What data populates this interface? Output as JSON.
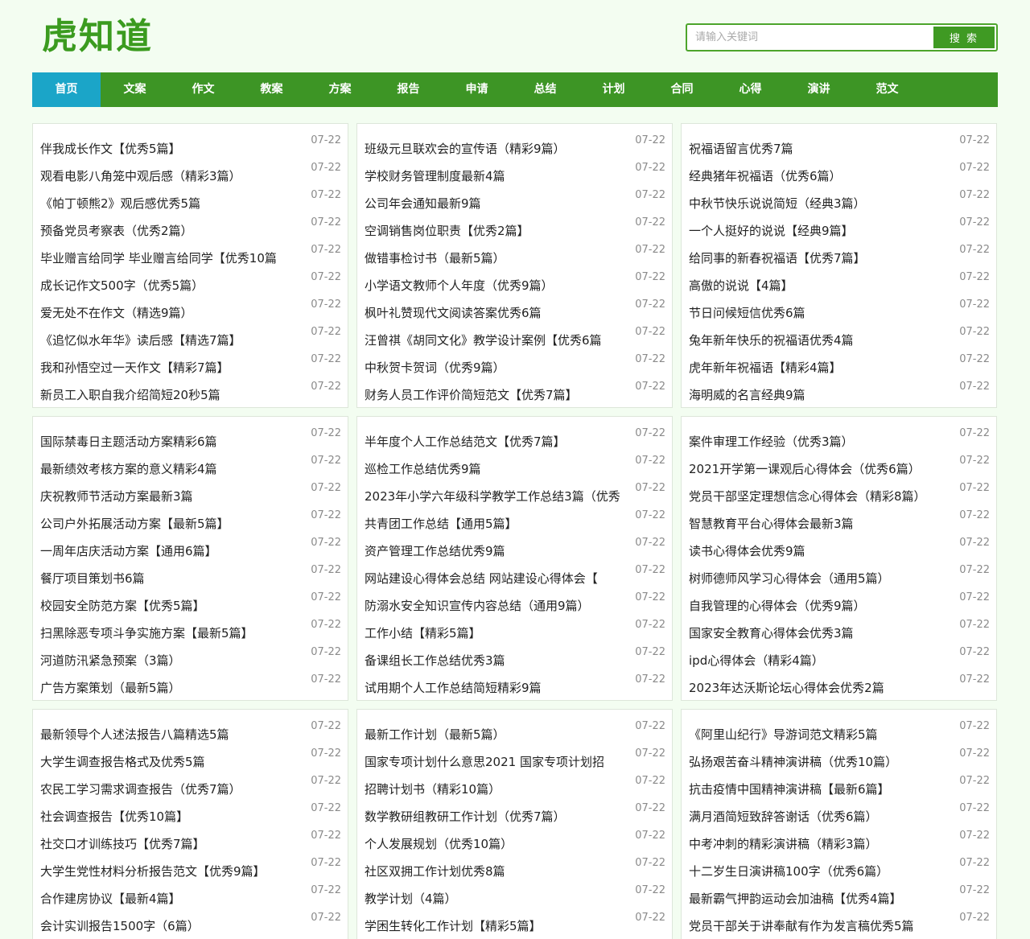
{
  "site": {
    "logo_text": "虎知道"
  },
  "search": {
    "placeholder": "请输入关键词",
    "button_label": "搜 索"
  },
  "nav": [
    {
      "label": "首页",
      "active": true
    },
    {
      "label": "文案"
    },
    {
      "label": "作文"
    },
    {
      "label": "教案"
    },
    {
      "label": "方案"
    },
    {
      "label": "报告"
    },
    {
      "label": "申请"
    },
    {
      "label": "总结"
    },
    {
      "label": "计划"
    },
    {
      "label": "合同"
    },
    {
      "label": "心得"
    },
    {
      "label": "演讲"
    },
    {
      "label": "范文"
    }
  ],
  "boxes": [
    {
      "items": [
        {
          "title": "伴我成长作文【优秀5篇】",
          "date": "07-22"
        },
        {
          "title": "观看电影八角笼中观后感（精彩3篇）",
          "date": "07-22"
        },
        {
          "title": "《帕丁顿熊2》观后感优秀5篇",
          "date": "07-22"
        },
        {
          "title": "预备党员考察表（优秀2篇）",
          "date": "07-22"
        },
        {
          "title": "毕业赠言给同学 毕业赠言给同学【优秀10篇",
          "date": "07-22"
        },
        {
          "title": "成长记作文500字（优秀5篇）",
          "date": "07-22"
        },
        {
          "title": "爱无处不在作文（精选9篇）",
          "date": "07-22"
        },
        {
          "title": "《追忆似水年华》读后感【精选7篇】",
          "date": "07-22"
        },
        {
          "title": "我和孙悟空过一天作文【精彩7篇】",
          "date": "07-22"
        },
        {
          "title": "新员工入职自我介绍简短20秒5篇",
          "date": "07-22"
        }
      ]
    },
    {
      "items": [
        {
          "title": "班级元旦联欢会的宣传语（精彩9篇）",
          "date": "07-22"
        },
        {
          "title": "学校财务管理制度最新4篇",
          "date": "07-22"
        },
        {
          "title": "公司年会通知最新9篇",
          "date": "07-22"
        },
        {
          "title": "空调销售岗位职责【优秀2篇】",
          "date": "07-22"
        },
        {
          "title": "做错事检讨书（最新5篇）",
          "date": "07-22"
        },
        {
          "title": "小学语文教师个人年度（优秀9篇）",
          "date": "07-22"
        },
        {
          "title": "枫叶礼赞现代文阅读答案优秀6篇",
          "date": "07-22"
        },
        {
          "title": "汪曾祺《胡同文化》教学设计案例【优秀6篇",
          "date": "07-22"
        },
        {
          "title": "中秋贺卡贺词（优秀9篇）",
          "date": "07-22"
        },
        {
          "title": "财务人员工作评价简短范文【优秀7篇】",
          "date": "07-22"
        }
      ]
    },
    {
      "items": [
        {
          "title": "祝福语留言优秀7篇",
          "date": "07-22"
        },
        {
          "title": "经典猪年祝福语（优秀6篇）",
          "date": "07-22"
        },
        {
          "title": "中秋节快乐说说简短（经典3篇）",
          "date": "07-22"
        },
        {
          "title": "一个人挺好的说说【经典9篇】",
          "date": "07-22"
        },
        {
          "title": "给同事的新春祝福语【优秀7篇】",
          "date": "07-22"
        },
        {
          "title": "高傲的说说【4篇】",
          "date": "07-22"
        },
        {
          "title": "节日问候短信优秀6篇",
          "date": "07-22"
        },
        {
          "title": "兔年新年快乐的祝福语优秀4篇",
          "date": "07-22"
        },
        {
          "title": "虎年新年祝福语【精彩4篇】",
          "date": "07-22"
        },
        {
          "title": "海明威的名言经典9篇",
          "date": "07-22"
        }
      ]
    },
    {
      "items": [
        {
          "title": "国际禁毒日主题活动方案精彩6篇",
          "date": "07-22"
        },
        {
          "title": "最新绩效考核方案的意义精彩4篇",
          "date": "07-22"
        },
        {
          "title": "庆祝教师节活动方案最新3篇",
          "date": "07-22"
        },
        {
          "title": "公司户外拓展活动方案【最新5篇】",
          "date": "07-22"
        },
        {
          "title": "一周年店庆活动方案【通用6篇】",
          "date": "07-22"
        },
        {
          "title": "餐厅项目策划书6篇",
          "date": "07-22"
        },
        {
          "title": "校园安全防范方案【优秀5篇】",
          "date": "07-22"
        },
        {
          "title": "扫黑除恶专项斗争实施方案【最新5篇】",
          "date": "07-22"
        },
        {
          "title": "河道防汛紧急预案（3篇）",
          "date": "07-22"
        },
        {
          "title": "广告方案策划（最新5篇）",
          "date": "07-22"
        }
      ]
    },
    {
      "items": [
        {
          "title": "半年度个人工作总结范文【优秀7篇】",
          "date": "07-22"
        },
        {
          "title": "巡检工作总结优秀9篇",
          "date": "07-22"
        },
        {
          "title": "2023年小学六年级科学教学工作总结3篇（优秀",
          "date": "07-22"
        },
        {
          "title": "共青团工作总结【通用5篇】",
          "date": "07-22"
        },
        {
          "title": "资产管理工作总结优秀9篇",
          "date": "07-22"
        },
        {
          "title": "网站建设心得体会总结 网站建设心得体会【",
          "date": "07-22"
        },
        {
          "title": "防溺水安全知识宣传内容总结（通用9篇）",
          "date": "07-22"
        },
        {
          "title": "工作小结【精彩5篇】",
          "date": "07-22"
        },
        {
          "title": "备课组长工作总结优秀3篇",
          "date": "07-22"
        },
        {
          "title": "试用期个人工作总结简短精彩9篇",
          "date": "07-22"
        }
      ]
    },
    {
      "items": [
        {
          "title": "案件审理工作经验（优秀3篇）",
          "date": "07-22"
        },
        {
          "title": "2021开学第一课观后心得体会（优秀6篇）",
          "date": "07-22"
        },
        {
          "title": "党员干部坚定理想信念心得体会（精彩8篇）",
          "date": "07-22"
        },
        {
          "title": "智慧教育平台心得体会最新3篇",
          "date": "07-22"
        },
        {
          "title": "读书心得体会优秀9篇",
          "date": "07-22"
        },
        {
          "title": "树师德师风学习心得体会（通用5篇）",
          "date": "07-22"
        },
        {
          "title": "自我管理的心得体会（优秀9篇）",
          "date": "07-22"
        },
        {
          "title": "国家安全教育心得体会优秀3篇",
          "date": "07-22"
        },
        {
          "title": "ipd心得体会（精彩4篇）",
          "date": "07-22"
        },
        {
          "title": "2023年达沃斯论坛心得体会优秀2篇",
          "date": "07-22"
        }
      ]
    },
    {
      "items": [
        {
          "title": "最新领导个人述法报告八篇精选5篇",
          "date": "07-22"
        },
        {
          "title": "大学生调查报告格式及优秀5篇",
          "date": "07-22"
        },
        {
          "title": "农民工学习需求调查报告（优秀7篇）",
          "date": "07-22"
        },
        {
          "title": "社会调查报告【优秀10篇】",
          "date": "07-22"
        },
        {
          "title": "社交口才训练技巧【优秀7篇】",
          "date": "07-22"
        },
        {
          "title": "大学生党性材料分析报告范文【优秀9篇】",
          "date": "07-22"
        },
        {
          "title": "合作建房协议【最新4篇】",
          "date": "07-22"
        },
        {
          "title": "会计实训报告1500字（6篇）",
          "date": "07-22"
        }
      ]
    },
    {
      "items": [
        {
          "title": "最新工作计划（最新5篇）",
          "date": "07-22"
        },
        {
          "title": "国家专项计划什么意思2021 国家专项计划招",
          "date": "07-22"
        },
        {
          "title": "招聘计划书（精彩10篇）",
          "date": "07-22"
        },
        {
          "title": "数学教研组教研工作计划（优秀7篇）",
          "date": "07-22"
        },
        {
          "title": "个人发展规划（优秀10篇）",
          "date": "07-22"
        },
        {
          "title": "社区双拥工作计划优秀8篇",
          "date": "07-22"
        },
        {
          "title": "教学计划（4篇）",
          "date": "07-22"
        },
        {
          "title": "学困生转化工作计划【精彩5篇】",
          "date": "07-22"
        }
      ]
    },
    {
      "items": [
        {
          "title": "《阿里山纪行》导游词范文精彩5篇",
          "date": "07-22"
        },
        {
          "title": "弘扬艰苦奋斗精神演讲稿（优秀10篇）",
          "date": "07-22"
        },
        {
          "title": "抗击疫情中国精神演讲稿【最新6篇】",
          "date": "07-22"
        },
        {
          "title": "满月酒简短致辞答谢话（优秀6篇）",
          "date": "07-22"
        },
        {
          "title": "中考冲刺的精彩演讲稿（精彩3篇）",
          "date": "07-22"
        },
        {
          "title": "十二岁生日演讲稿100字（优秀6篇）",
          "date": "07-22"
        },
        {
          "title": "最新霸气押韵运动会加油稿【优秀4篇】",
          "date": "07-22"
        },
        {
          "title": "党员干部关于讲奉献有作为发言稿优秀5篇",
          "date": "07-22"
        }
      ]
    }
  ]
}
